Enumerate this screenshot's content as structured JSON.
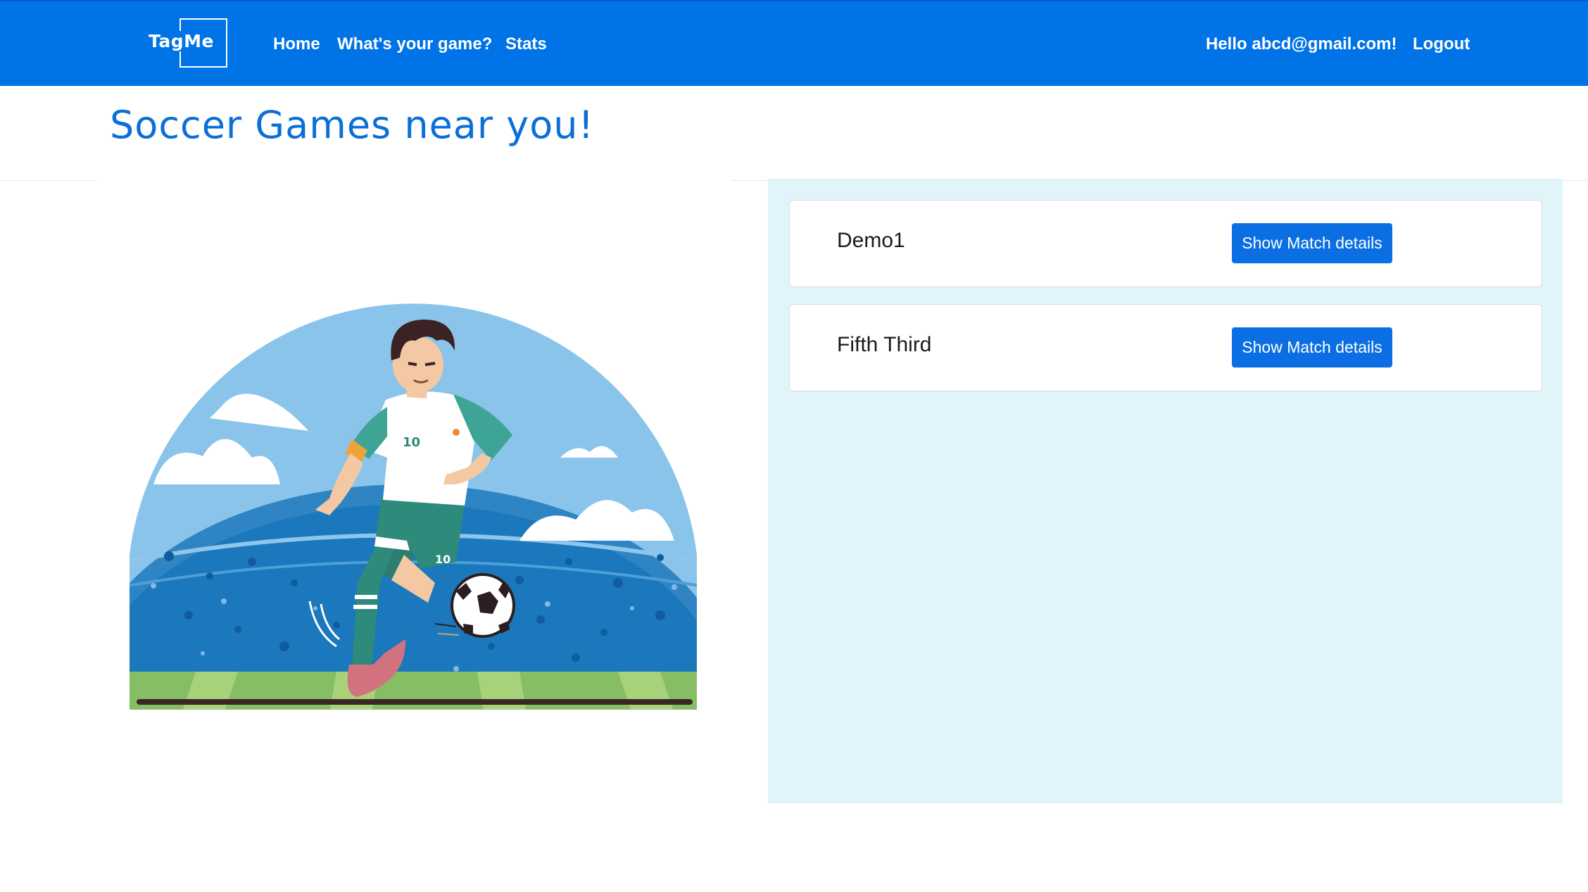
{
  "nav": {
    "brand": "TagMe",
    "links": [
      "Home",
      "What's your game?",
      "Stats"
    ],
    "greeting": "Hello abcd@gmail.com!",
    "logout": "Logout"
  },
  "page": {
    "title": "Soccer Games near you!"
  },
  "matches": [
    {
      "name": "Demo1",
      "button": "Show Match details"
    },
    {
      "name": "Fifth Third",
      "button": "Show Match details"
    }
  ],
  "illustration": {
    "jersey_number": "10",
    "shorts_number": "10"
  },
  "colors": {
    "primary": "#0073e6",
    "panel_bg": "#e0f4fa",
    "title": "#0b6fd7"
  }
}
